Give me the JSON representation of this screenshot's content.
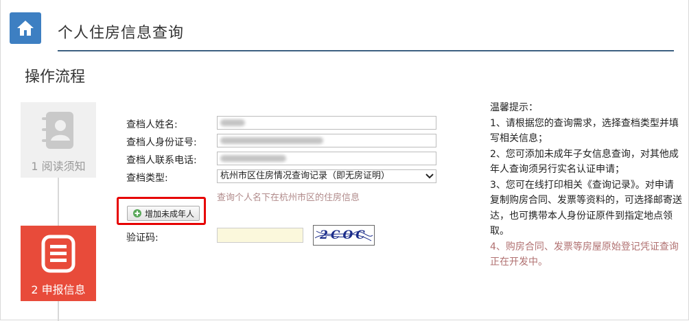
{
  "header": {
    "title": "个人住房信息查询"
  },
  "section": {
    "title": "操作流程"
  },
  "steps": [
    {
      "label": "1 阅读须知",
      "state": "inactive",
      "icon": "contact-book-icon"
    },
    {
      "label": "2 申报信息",
      "state": "active",
      "icon": "form-list-icon"
    }
  ],
  "form": {
    "name_label": "查档人姓名:",
    "name_value": "",
    "id_label": "查档人身份证号:",
    "id_value": "",
    "phone_label": "查档人联系电话:",
    "phone_value": "",
    "type_label": "查档类型:",
    "type_value": "杭州市区住房情况查询记录（即无房证明）",
    "type_hint": "查询个人名下在杭州市区的住房信息",
    "add_minor_label": "增加未成年人",
    "captcha_label": "验证码:",
    "captcha_value": "",
    "captcha_image_text": "2COC"
  },
  "tips": {
    "title": "温馨提示：",
    "items": [
      "1、请根据您的查询需求，选择查档类型并填写相关信息；",
      "2、您可添加未成年子女信息查询，对其他成年人查询须另行实名认证申请；",
      "3、您可在线打印相关《查询记录》。对申请复制购房合同、发票等资料的，可选择邮寄送达，也可携带本人身份证原件到指定地点领取。",
      "4、购房合同、发票等房屋原始登记凭证查询正在开发中。"
    ]
  },
  "colors": {
    "accent_blue": "#3d7fc2",
    "active_step": "#e84b3a",
    "highlight": "#e60000",
    "hint": "#b08a8a"
  }
}
